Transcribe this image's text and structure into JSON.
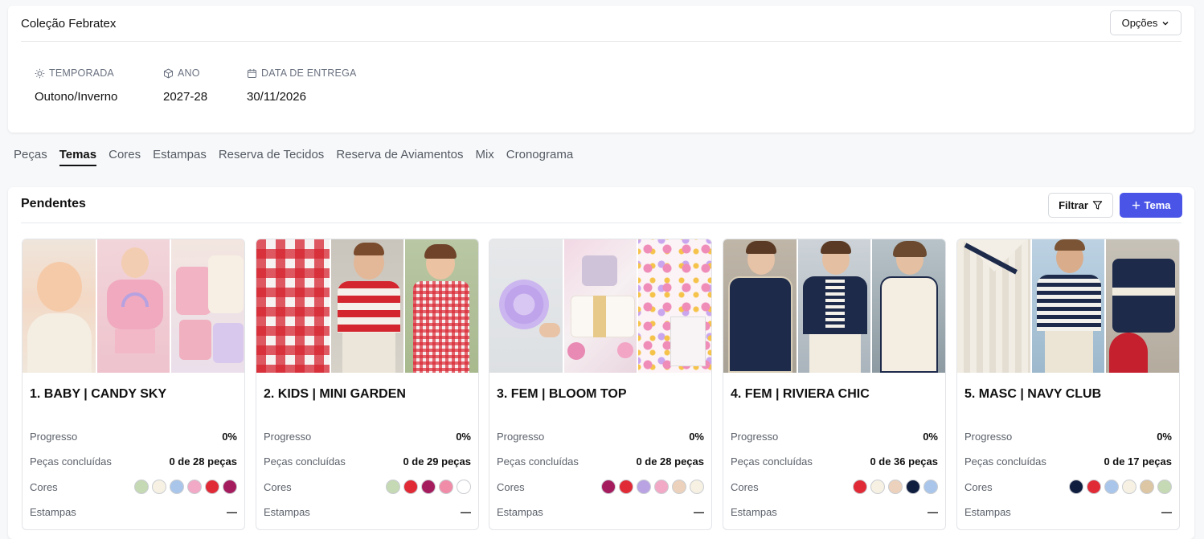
{
  "header": {
    "title": "Coleção Febratex",
    "options_label": "Opções",
    "season_label": "TEMPORADA",
    "season_value": "Outono/Inverno",
    "year_label": "ANO",
    "year_value": "2027-28",
    "delivery_label": "DATA DE ENTREGA",
    "delivery_value": "30/11/2026"
  },
  "tabs": [
    "Peças",
    "Temas",
    "Cores",
    "Estampas",
    "Reserva de Tecidos",
    "Reserva de Aviamentos",
    "Mix",
    "Cronograma"
  ],
  "active_tab": "Temas",
  "section": {
    "title": "Pendentes",
    "filter_label": "Filtrar",
    "add_label": "Tema"
  },
  "labels": {
    "progress": "Progresso",
    "pieces": "Peças concluídas",
    "colors": "Cores",
    "prints": "Estampas"
  },
  "themes": [
    {
      "title": "1. BABY | CANDY SKY",
      "progress": "0%",
      "pieces": "0 de 28 peças",
      "prints": "—",
      "colors": [
        "#c5d9b4",
        "#f6f1e3",
        "#a9c6ea",
        "#f2a9c6",
        "#e02a36",
        "#a51c5e"
      ],
      "photos": [
        "baby-photo",
        "toddler-rainbow-hoodie-photo",
        "pink-clothing-flatlay-photo"
      ]
    },
    {
      "title": "2. KIDS | MINI GARDEN",
      "progress": "0%",
      "pieces": "0 de 29 peças",
      "prints": "—",
      "colors": [
        "#c5d9b4",
        "#e02a36",
        "#a51c5e",
        "#f08ca8",
        "#ffffff"
      ],
      "photos": [
        "gingham-fabric-photo",
        "boy-striped-sweater-photo",
        "girl-gingham-dress-photo"
      ]
    },
    {
      "title": "3. FEM | BLOOM TOP",
      "progress": "0%",
      "pieces": "0 de 28 peças",
      "prints": "—",
      "colors": [
        "#a51c5e",
        "#e02a36",
        "#b9a3e3",
        "#f2a9c6",
        "#ecd2bc",
        "#f6f1e3"
      ],
      "photos": [
        "lilac-flower-photo",
        "chanel-bag-flatlay-photo",
        "floral-collage-photo"
      ]
    },
    {
      "title": "4. FEM | RIVIERA CHIC",
      "progress": "0%",
      "pieces": "0 de 36 peças",
      "prints": "—",
      "colors": [
        "#e02a36",
        "#f6f1e3",
        "#ecd2bc",
        "#0f1d3f",
        "#a9c6ea"
      ],
      "photos": [
        "navy-tweed-jacket-photo",
        "navy-jacket-stripes-photo",
        "cream-dress-photo"
      ]
    },
    {
      "title": "5. MASC | NAVY CLUB",
      "progress": "0%",
      "pieces": "0 de 17 peças",
      "prints": "—",
      "colors": [
        "#0f1d3f",
        "#e02a36",
        "#a9c6ea",
        "#f6f1e3",
        "#dcc6a3",
        "#c5d9b4"
      ],
      "photos": [
        "cable-knit-sweater-photo",
        "man-striped-shirt-photo",
        "navy-tote-bag-photo"
      ]
    }
  ],
  "icons": {
    "season": "sun-icon",
    "year": "cube-icon",
    "delivery": "calendar-icon",
    "options": "chevron-down-icon",
    "filter": "filter-icon",
    "add": "plus-icon"
  },
  "colors": {
    "accent": "#4a55e8",
    "background": "#f7f8fa"
  }
}
